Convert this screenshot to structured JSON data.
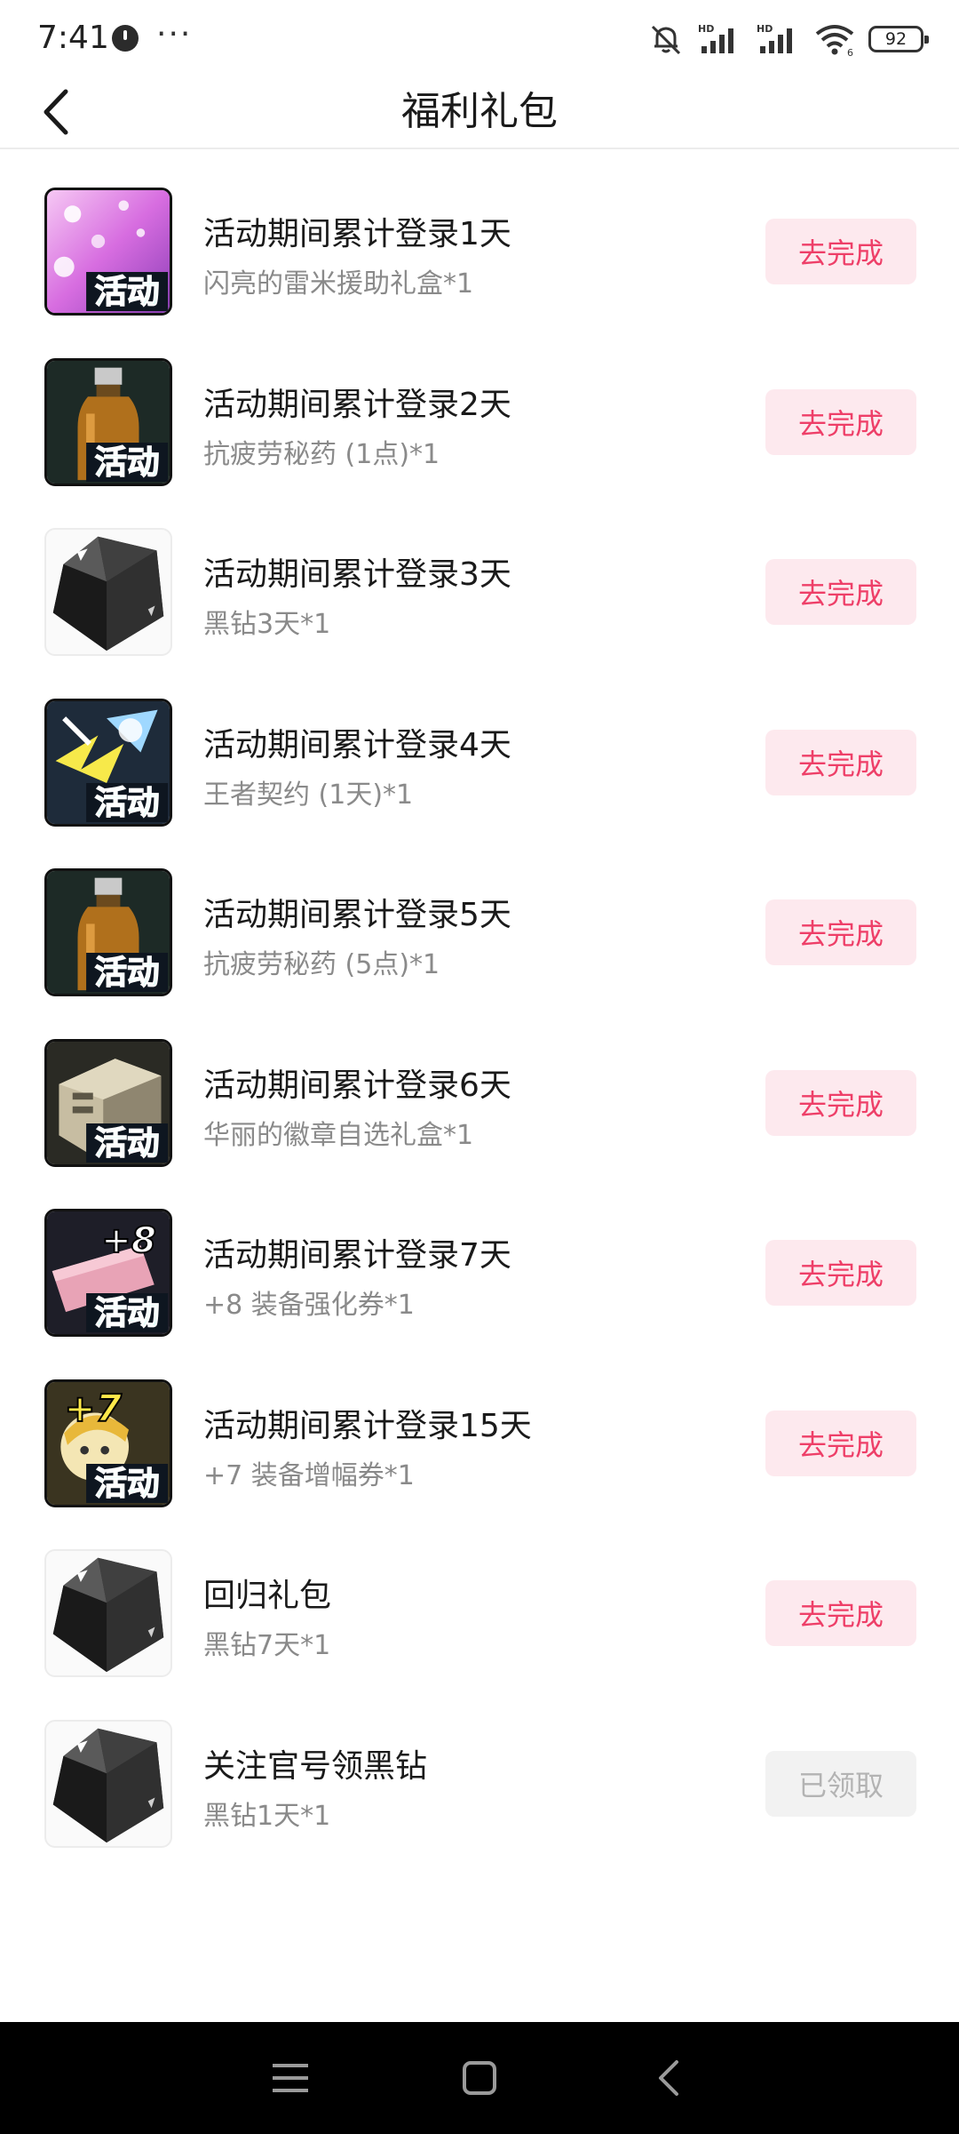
{
  "status_bar": {
    "time": "7:41",
    "dots": "···",
    "battery": "92"
  },
  "header": {
    "title": "福利礼包"
  },
  "colors": {
    "accent": "#ee3f68",
    "accent_bg": "#fde9ee",
    "disabled_text": "#b3b3b3",
    "disabled_bg": "#f2f2f2",
    "nav_bg": "#000000"
  },
  "items": [
    {
      "title": "活动期间累计登录1天",
      "subtitle": "闪亮的雷米援助礼盒*1",
      "action": "去完成",
      "icon": "sparkle-box-icon"
    },
    {
      "title": "活动期间累计登录2天",
      "subtitle": "抗疲劳秘药 (1点)*1",
      "action": "去完成",
      "icon": "potion-bottle-icon"
    },
    {
      "title": "活动期间累计登录3天",
      "subtitle": "黑钻3天*1",
      "action": "去完成",
      "icon": "black-diamond-icon"
    },
    {
      "title": "活动期间累计登录4天",
      "subtitle": "王者契约 (1天)*1",
      "action": "去完成",
      "icon": "king-contract-icon"
    },
    {
      "title": "活动期间累计登录5天",
      "subtitle": "抗疲劳秘药 (5点)*1",
      "action": "去完成",
      "icon": "potion-bottle-icon"
    },
    {
      "title": "活动期间累计登录6天",
      "subtitle": "华丽的徽章自选礼盒*1",
      "action": "去完成",
      "icon": "emblem-box-icon"
    },
    {
      "title": "活动期间累计登录7天",
      "subtitle": "+8 装备强化券*1",
      "action": "去完成",
      "icon": "plus8-ticket-icon"
    },
    {
      "title": "活动期间累计登录15天",
      "subtitle": "+7 装备增幅券*1",
      "action": "去完成",
      "icon": "plus7-ticket-icon"
    },
    {
      "title": "回归礼包",
      "subtitle": "黑钻7天*1",
      "action": "去完成",
      "icon": "black-diamond-icon"
    },
    {
      "title": "关注官号领黑钻",
      "subtitle": "黑钻1天*1",
      "action": "已领取",
      "icon": "black-diamond-icon"
    }
  ],
  "badge_text": "活动"
}
